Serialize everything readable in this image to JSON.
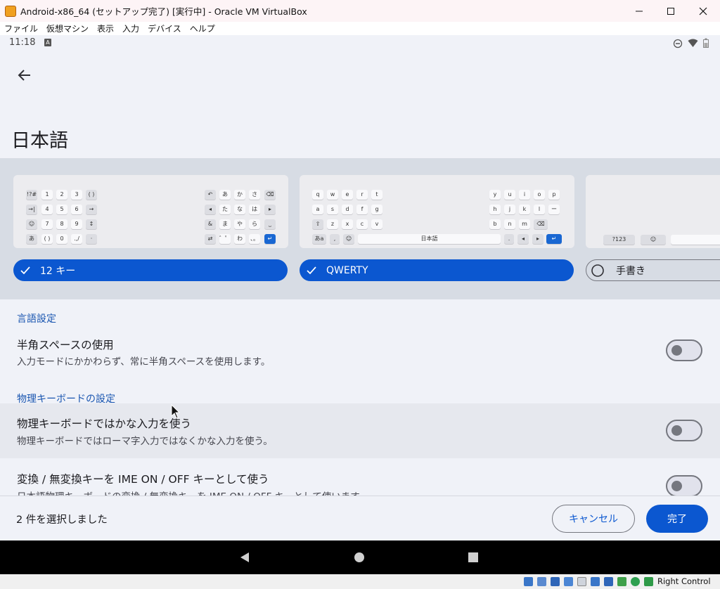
{
  "window": {
    "title": "Android-x86_64 (セットアップ完了) [実行中] - Oracle VM VirtualBox",
    "menu": [
      "ファイル",
      "仮想マシン",
      "表示",
      "入力",
      "デバイス",
      "ヘルプ"
    ]
  },
  "status_bar": {
    "time": "11:18",
    "badge": "A"
  },
  "page": {
    "title": "日本語"
  },
  "layouts": [
    {
      "label": "12 キー",
      "selected": true
    },
    {
      "label": "QWERTY",
      "selected": true
    },
    {
      "label": "手書き",
      "selected": false
    }
  ],
  "keyboard_12key": {
    "left": [
      [
        "!?#",
        "1",
        "2",
        "3",
        "( )"
      ],
      [
        "→|",
        "4",
        "5",
        "6",
        "→"
      ],
      [
        "☺",
        "7",
        "8",
        "9",
        "↕"
      ],
      [
        "あ",
        "( )",
        "0",
        ".,/",
        "·"
      ]
    ],
    "right": [
      [
        "↶",
        "あ",
        "か",
        "さ",
        "⌫"
      ],
      [
        "◂",
        "た",
        "な",
        "は",
        "▸"
      ],
      [
        "&",
        "ま",
        "や",
        "ら",
        "⎵"
      ],
      [
        "⇄",
        "゛゜",
        "わ",
        "、。",
        "↵"
      ]
    ]
  },
  "keyboard_qwerty": {
    "row1_left": [
      "q",
      "w",
      "e",
      "r",
      "t"
    ],
    "row1_right": [
      "y",
      "u",
      "i",
      "o",
      "p"
    ],
    "row2_left": [
      "a",
      "s",
      "d",
      "f",
      "g"
    ],
    "row2_right": [
      "h",
      "j",
      "k",
      "l",
      "ー"
    ],
    "row3_left": [
      "⇧",
      "z",
      "x",
      "c",
      "v"
    ],
    "row3_right": [
      "b",
      "n",
      "m",
      "⌫"
    ],
    "space_label": "日本語",
    "row4_left": [
      "あa",
      ",",
      "☺"
    ],
    "row4_right": [
      ".",
      "◂",
      "▸",
      "↵"
    ]
  },
  "keyboard_hand": {
    "num_label": "?123",
    "emoji": "☺"
  },
  "settings": {
    "section_language": "言語設定",
    "half_space": {
      "title": "半角スペースの使用",
      "subtitle": "入力モードにかかわらず、常に半角スペースを使用します。",
      "enabled": false
    },
    "section_physical": "物理キーボードの設定",
    "kana_input": {
      "title": "物理キーボードではかな入力を使う",
      "subtitle": "物理キーボードではローマ字入力ではなくかな入力を使う。",
      "enabled": false
    },
    "ime_key": {
      "title": "変換 / 無変換キーを IME ON / OFF キーとして使う",
      "subtitle": "日本語物理キーボードの変換 / 無変換キーを IME ON / OFF キーとして使います",
      "enabled": false
    }
  },
  "action_bar": {
    "selection": "2 件を選択しました",
    "cancel": "キャンセル",
    "done": "完了"
  },
  "vbox_status": {
    "host_key": "Right Control"
  },
  "colors": {
    "accent": "#0b57d0",
    "background": "#f0f2f8",
    "carousel_bg": "#d7dce4"
  }
}
